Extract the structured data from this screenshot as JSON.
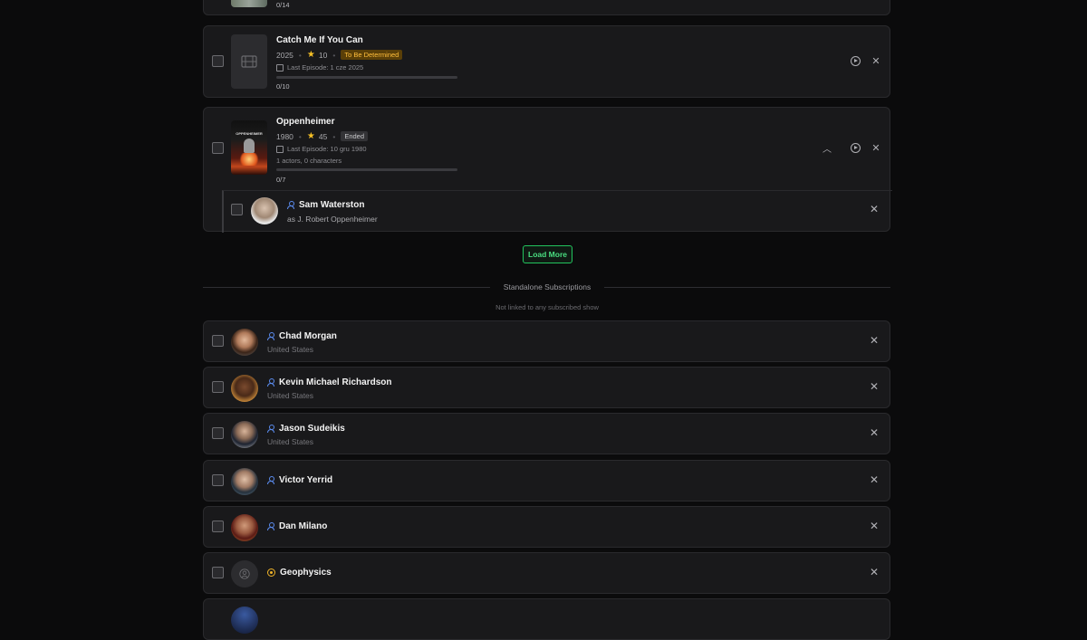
{
  "top_card": {
    "progress_text": "0/14"
  },
  "shows": [
    {
      "title": "Catch Me If You Can",
      "year": "2025",
      "rating": "10",
      "status": "To Be Determined",
      "last_episode": "Last Episode: 1 cze 2025",
      "progress_text": "0/10",
      "progress_fraction": 0
    },
    {
      "title": "Oppenheimer",
      "year": "1980",
      "rating": "45",
      "status": "Ended",
      "last_episode": "Last Episode: 10 gru 1980",
      "cast_summary": "1 actors, 0 characters",
      "progress_text": "0/7",
      "progress_fraction": 0,
      "poster_text": "OPPENHEIMER",
      "actor": {
        "name": "Sam Waterston",
        "role": "as J. Robert Oppenheimer"
      }
    }
  ],
  "load_more_label": "Load More",
  "standalone": {
    "heading": "Standalone Subscriptions",
    "subheading": "Not linked to any subscribed show",
    "items": [
      {
        "name": "Chad Morgan",
        "country": "United States",
        "kind": "person"
      },
      {
        "name": "Kevin Michael Richardson",
        "country": "United States",
        "kind": "person"
      },
      {
        "name": "Jason Sudeikis",
        "country": "United States",
        "kind": "person"
      },
      {
        "name": "Victor Yerrid",
        "country": "",
        "kind": "person"
      },
      {
        "name": "Dan Milano",
        "country": "",
        "kind": "person"
      },
      {
        "name": "Geophysics",
        "country": "",
        "kind": "organization"
      }
    ]
  },
  "colors": {
    "accent": "#22c55e",
    "tbd_badge": "#ffbe3c",
    "person_icon": "#5b8cf0",
    "org_icon": "#f0b429",
    "star": "#f6c026"
  },
  "icons": [
    "film-icon",
    "star-icon",
    "calendar-icon",
    "play-circle-icon",
    "close-icon",
    "chevron-up-icon",
    "person-icon",
    "building-icon"
  ]
}
